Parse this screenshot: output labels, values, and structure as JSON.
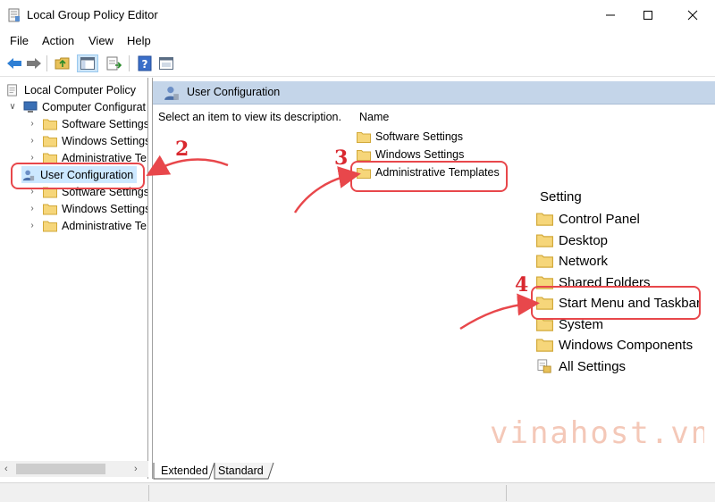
{
  "window": {
    "title": "Local Group Policy Editor",
    "minimize_icon": "minimize-icon",
    "maximize_icon": "maximize-icon",
    "close_icon": "close-icon"
  },
  "menu": [
    "File",
    "Action",
    "View",
    "Help"
  ],
  "toolbar": {
    "buttons": [
      "back-arrow-icon",
      "forward-arrow-icon",
      "up-folder-icon",
      "show-hide-tree-icon",
      "export-list-icon",
      "help-icon",
      "properties-icon"
    ]
  },
  "tree": {
    "root": "Local Computer Policy",
    "computer_config": "Computer Configurat",
    "cc_children": [
      "Software Settings",
      "Windows Settings",
      "Administrative Te"
    ],
    "user_config": "User Configuration",
    "uc_children": [
      "Software Settings",
      "Windows Settings",
      "Administrative Te"
    ]
  },
  "right_pane": {
    "header_title": "User Configuration",
    "description": "Select an item to view its description.",
    "column_name": "Name",
    "items": [
      "Software Settings",
      "Windows Settings",
      "Administrative Templates"
    ]
  },
  "inset": {
    "column_header": "Setting",
    "items": [
      "Control Panel",
      "Desktop",
      "Network",
      "Shared Folders",
      "Start Menu and Taskbar",
      "System",
      "Windows Components",
      "All Settings"
    ]
  },
  "tabs": [
    "Extended",
    "Standard"
  ],
  "annotations": {
    "step2": "2",
    "step3": "3",
    "step4": "4",
    "color": "#e8474b"
  },
  "watermark": {
    "text": "vinahost.vn",
    "color": "#f2c4b4"
  }
}
